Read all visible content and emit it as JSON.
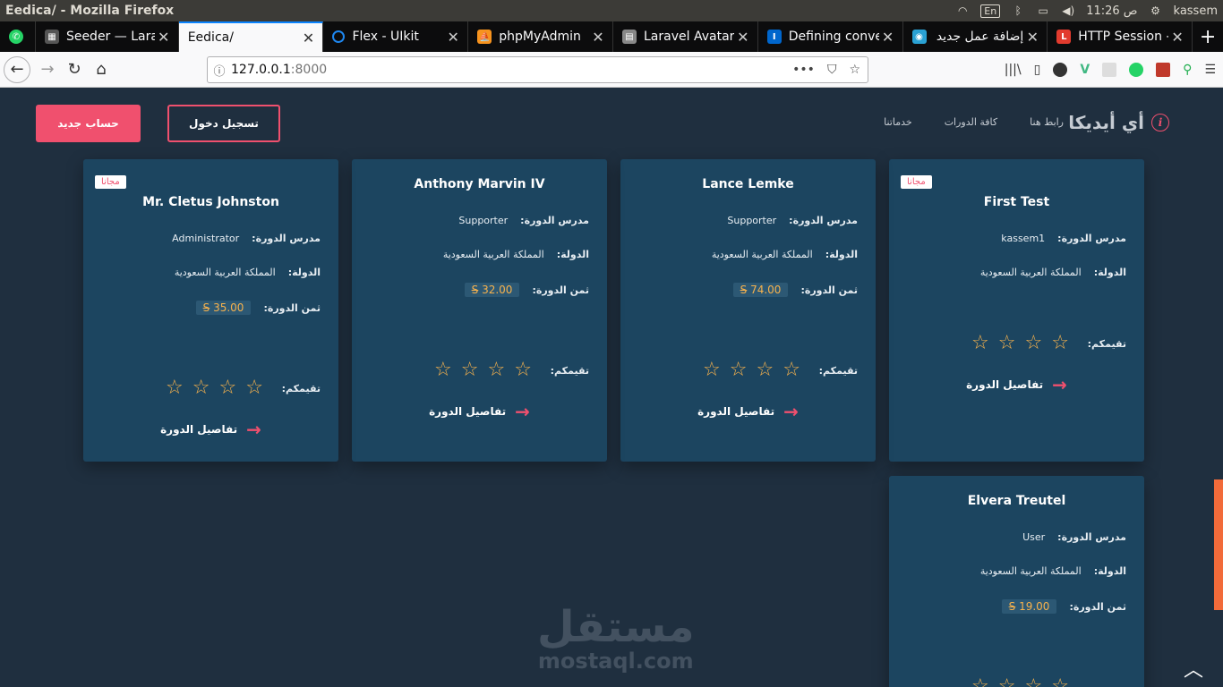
{
  "os": {
    "window_title": "Eedica/ - Mozilla Firefox",
    "lang": "En",
    "time": "11:26 ص",
    "user": "kassem"
  },
  "tabs": [
    {
      "title": "",
      "fav_color": "#25d366",
      "fav_glyph": "✆"
    },
    {
      "title": "Seeder — Lara",
      "fav_color": "#555",
      "fav_glyph": "▦"
    },
    {
      "title": "Eedica/",
      "fav_color": "",
      "fav_glyph": ""
    },
    {
      "title": "Flex - UIkit",
      "fav_color": "#1e87f0",
      "fav_glyph": "U"
    },
    {
      "title": "phpMyAdmin",
      "fav_color": "#f7931e",
      "fav_glyph": "⛵"
    },
    {
      "title": "Laravel Avatar",
      "fav_color": "#888",
      "fav_glyph": "▤"
    },
    {
      "title": "Defining conve",
      "fav_color": "#0066cc",
      "fav_glyph": "I"
    },
    {
      "title": "إضافة عمل جديد",
      "fav_color": "#2aa1d3",
      "fav_glyph": "◉"
    },
    {
      "title": "HTTP Session -",
      "fav_color": "#e23b2e",
      "fav_glyph": "L"
    }
  ],
  "newtab": "+",
  "url": {
    "host": "127.0.0.1",
    "port": ":8000"
  },
  "icons": {
    "back": "back-icon",
    "forward": "forward-icon",
    "reload": "reload-icon",
    "home": "home-icon",
    "info": "info-icon",
    "more": "more-icon",
    "pocket": "pocket-icon",
    "star": "bookmark-star-icon",
    "library": "library-icon",
    "sidebar": "sidebar-icon",
    "menu": "menu-icon"
  },
  "site": {
    "logo": "أي أيديكا",
    "nav": [
      "رابط هنا",
      "كافة الدورات",
      "خدماتنا"
    ],
    "login": "تسجيل دخول",
    "signup": "حساب جديد"
  },
  "labels": {
    "instructor": "مدرس الدورة:",
    "country": "الدولة:",
    "price": "ثمن الدورة:",
    "rating": "تقيمكم:",
    "details": "تفاصيل الدورة",
    "free": "مجانا"
  },
  "courses": [
    {
      "name": "First Test",
      "instructor": "kassem1",
      "country": "المملكة العربية السعودية",
      "price": "",
      "free": true
    },
    {
      "name": "Lance Lemke",
      "instructor": "Supporter",
      "country": "المملكة العربية السعودية",
      "price": "74.00",
      "free": false
    },
    {
      "name": "Anthony Marvin IV",
      "instructor": "Supporter",
      "country": "المملكة العربية السعودية",
      "price": "32.00",
      "free": false
    },
    {
      "name": "Mr. Cletus Johnston",
      "instructor": "Administrator",
      "country": "المملكة العربية السعودية",
      "price": "35.00",
      "free": true
    },
    {
      "name": "Elvera Treutel",
      "instructor": "User",
      "country": "المملكة العربية السعودية",
      "price": "19.00",
      "free": false
    }
  ],
  "currency_symbol": "S",
  "watermark": {
    "arabic": "مستقل",
    "latin": "mostaql.com"
  }
}
